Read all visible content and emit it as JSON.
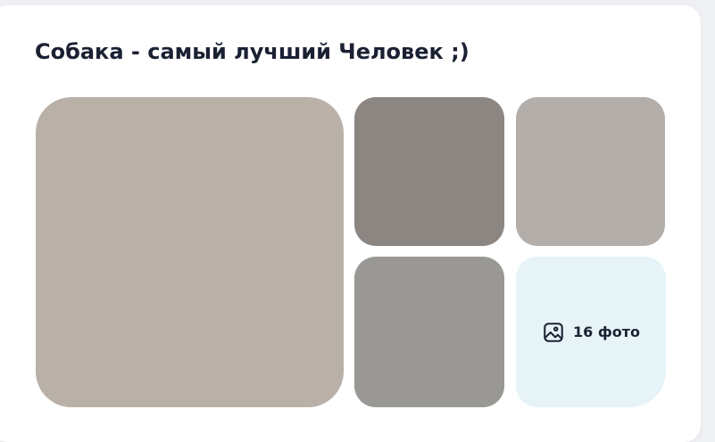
{
  "album": {
    "title": "Собака - самый лучший Человек ;)",
    "more": {
      "label": "16 фото",
      "icon": "image-gallery-icon"
    }
  },
  "colors": {
    "title": "#1b2133",
    "more_tile_bg": "#e6f4f8",
    "card_bg": "#ffffff",
    "page_bg": "#eef0f3"
  }
}
